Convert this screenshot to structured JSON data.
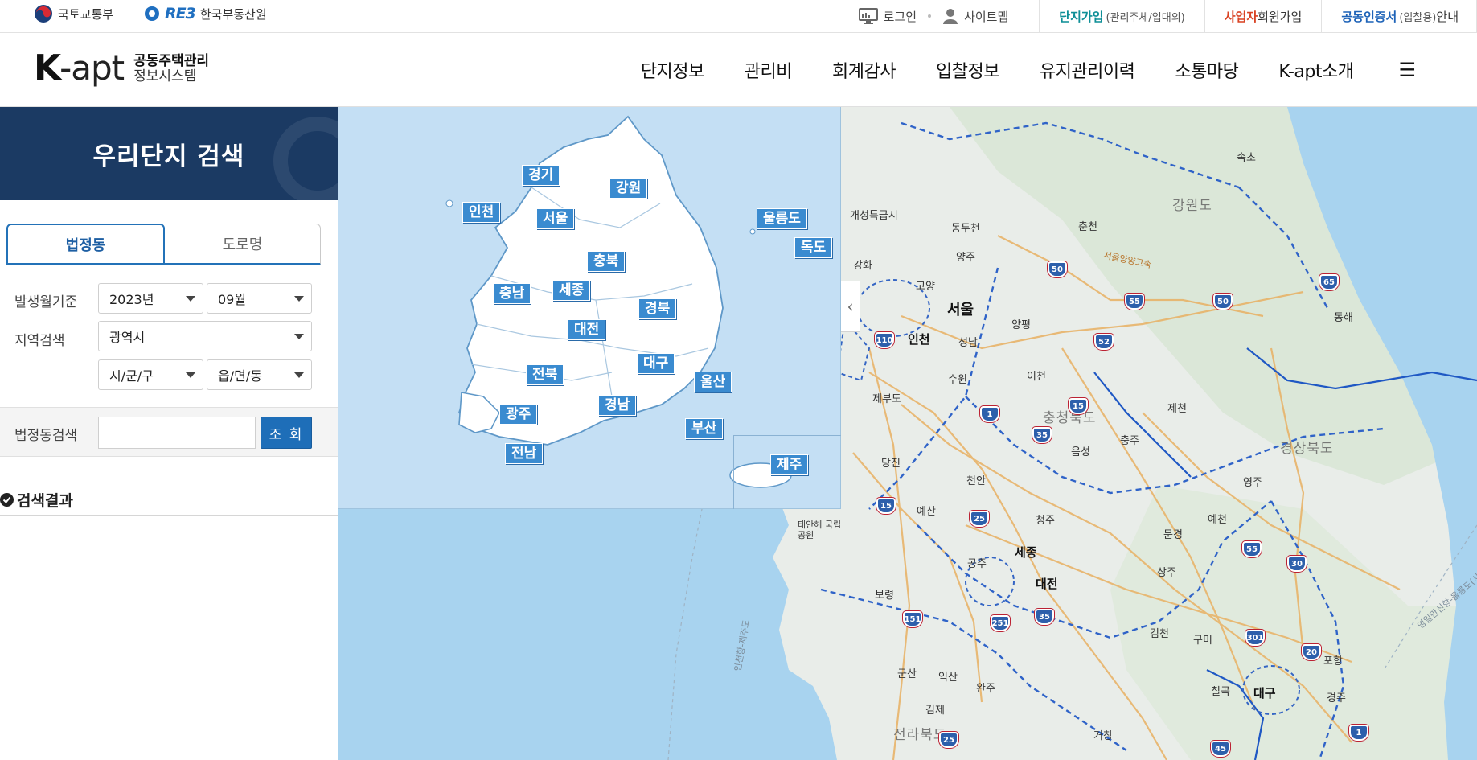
{
  "utility": {
    "org1": "국토교통부",
    "org2_mark": "RE3",
    "org2": "한국부동산원",
    "login": "로그인",
    "sitemap": "사이트맵",
    "complex_join_strong": "단지가입",
    "complex_join_sub": "(관리주체/입대의)",
    "biz_join_strong": "사업자",
    "biz_join_rest": " 회원가입",
    "cert_strong": "공동인증서",
    "cert_sub": "(입찰용)",
    "cert_rest": "안내"
  },
  "header": {
    "logo_k": "K",
    "logo_apt": "-apt",
    "logo_line1": "공동주택관리",
    "logo_line2": "정보시스템",
    "nav": [
      "단지정보",
      "관리비",
      "회계감사",
      "입찰정보",
      "유지관리이력",
      "소통마당",
      "K-apt소개"
    ],
    "menu_icon": "☰"
  },
  "sidebar": {
    "title": "우리단지 검색",
    "tabs": [
      "법정동",
      "도로명"
    ],
    "label_period": "발생월기준",
    "year": "2023년",
    "month": "09월",
    "label_region": "지역검색",
    "region": "광역시",
    "district": "시/군/구",
    "town": "읍/면/동",
    "label_search": "법정동검색",
    "search_value": "",
    "search_button": "조 회",
    "result_title": "검색결과"
  },
  "overlay_map": {
    "provinces": [
      "경기",
      "강원",
      "인천",
      "서울",
      "울릉도",
      "독도",
      "충북",
      "세종",
      "충남",
      "경북",
      "대전",
      "대구",
      "울산",
      "전북",
      "광주",
      "경남",
      "부산",
      "전남",
      "제주"
    ],
    "collapse_icon": "‹"
  },
  "base_map": {
    "regions": [
      "강원도",
      "충청북도",
      "경상북도",
      "전라북도"
    ],
    "major_cities": [
      "서울",
      "인천",
      "세종",
      "대전",
      "대구"
    ],
    "cities": [
      "속초",
      "개성특급시",
      "동두천",
      "춘천",
      "양주",
      "강화",
      "고양",
      "양평",
      "성남",
      "동해",
      "수원",
      "이천",
      "제부도",
      "제천",
      "충주",
      "음성",
      "당진",
      "천안",
      "영주",
      "예산",
      "청주",
      "예천",
      "문경",
      "공주",
      "상주",
      "보령",
      "군산",
      "익산",
      "김천",
      "구미",
      "완주",
      "김제",
      "칠곡",
      "거창",
      "포항",
      "경주",
      "태안해 국립공원"
    ],
    "routes": [
      "50",
      "65",
      "55",
      "50",
      "110",
      "52",
      "1",
      "15",
      "35",
      "15",
      "25",
      "55",
      "30",
      "151",
      "251",
      "35",
      "301",
      "20",
      "25",
      "45",
      "1"
    ],
    "road_label": "서울양양고속",
    "sea_route": "인천항-제주도",
    "sea_route2": "영일만신항-울릉도(사"
  },
  "colors": {
    "sidebar_header": "#1b3a63",
    "accent": "#1e6eb8",
    "province_badge": "#3a8bd0",
    "sea": "#a8d3ef",
    "land": "#e8ecea"
  }
}
